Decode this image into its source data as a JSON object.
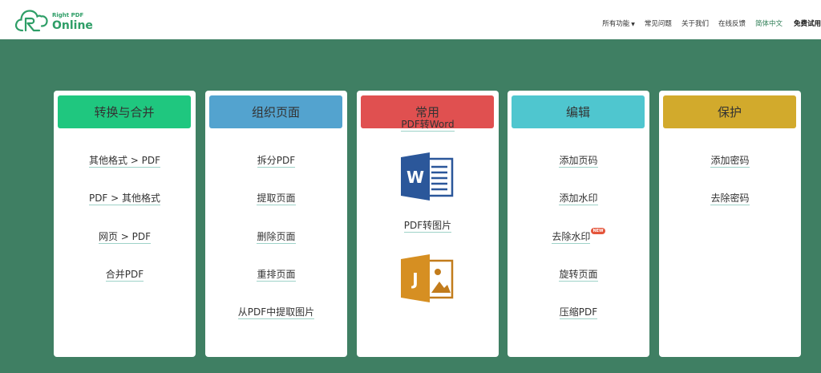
{
  "brand": {
    "small": "Right PDF",
    "big": "Online"
  },
  "nav": {
    "all_features": "所有功能",
    "faq": "常见问题",
    "about": "关于我们",
    "feedback": "在线反馈",
    "language": "简体中文",
    "trial": "免费试用"
  },
  "colors": {
    "background": "#3f7f63",
    "convert": "#1fc77f",
    "organize": "#53a3cf",
    "common": "#e05050",
    "edit": "#4fc6cf",
    "protect": "#d2aa2c"
  },
  "cards": [
    {
      "title": "转换与合并",
      "links": [
        "其他格式 > PDF",
        "PDF > 其他格式",
        "网页 > PDF",
        "合并PDF"
      ]
    },
    {
      "title": "组织页面",
      "links": [
        "拆分PDF",
        "提取页面",
        "删除页面",
        "重排页面",
        "从PDF中提取图片"
      ]
    },
    {
      "title": "常用",
      "links": [
        "PDF转Word",
        "PDF转图片"
      ],
      "icons": [
        "word-icon",
        "image-icon"
      ]
    },
    {
      "title": "编辑",
      "links": [
        "添加页码",
        "添加水印",
        "去除水印",
        "旋转页面",
        "压缩PDF"
      ],
      "badge": "NEW"
    },
    {
      "title": "保护",
      "links": [
        "添加密码",
        "去除密码"
      ]
    }
  ]
}
